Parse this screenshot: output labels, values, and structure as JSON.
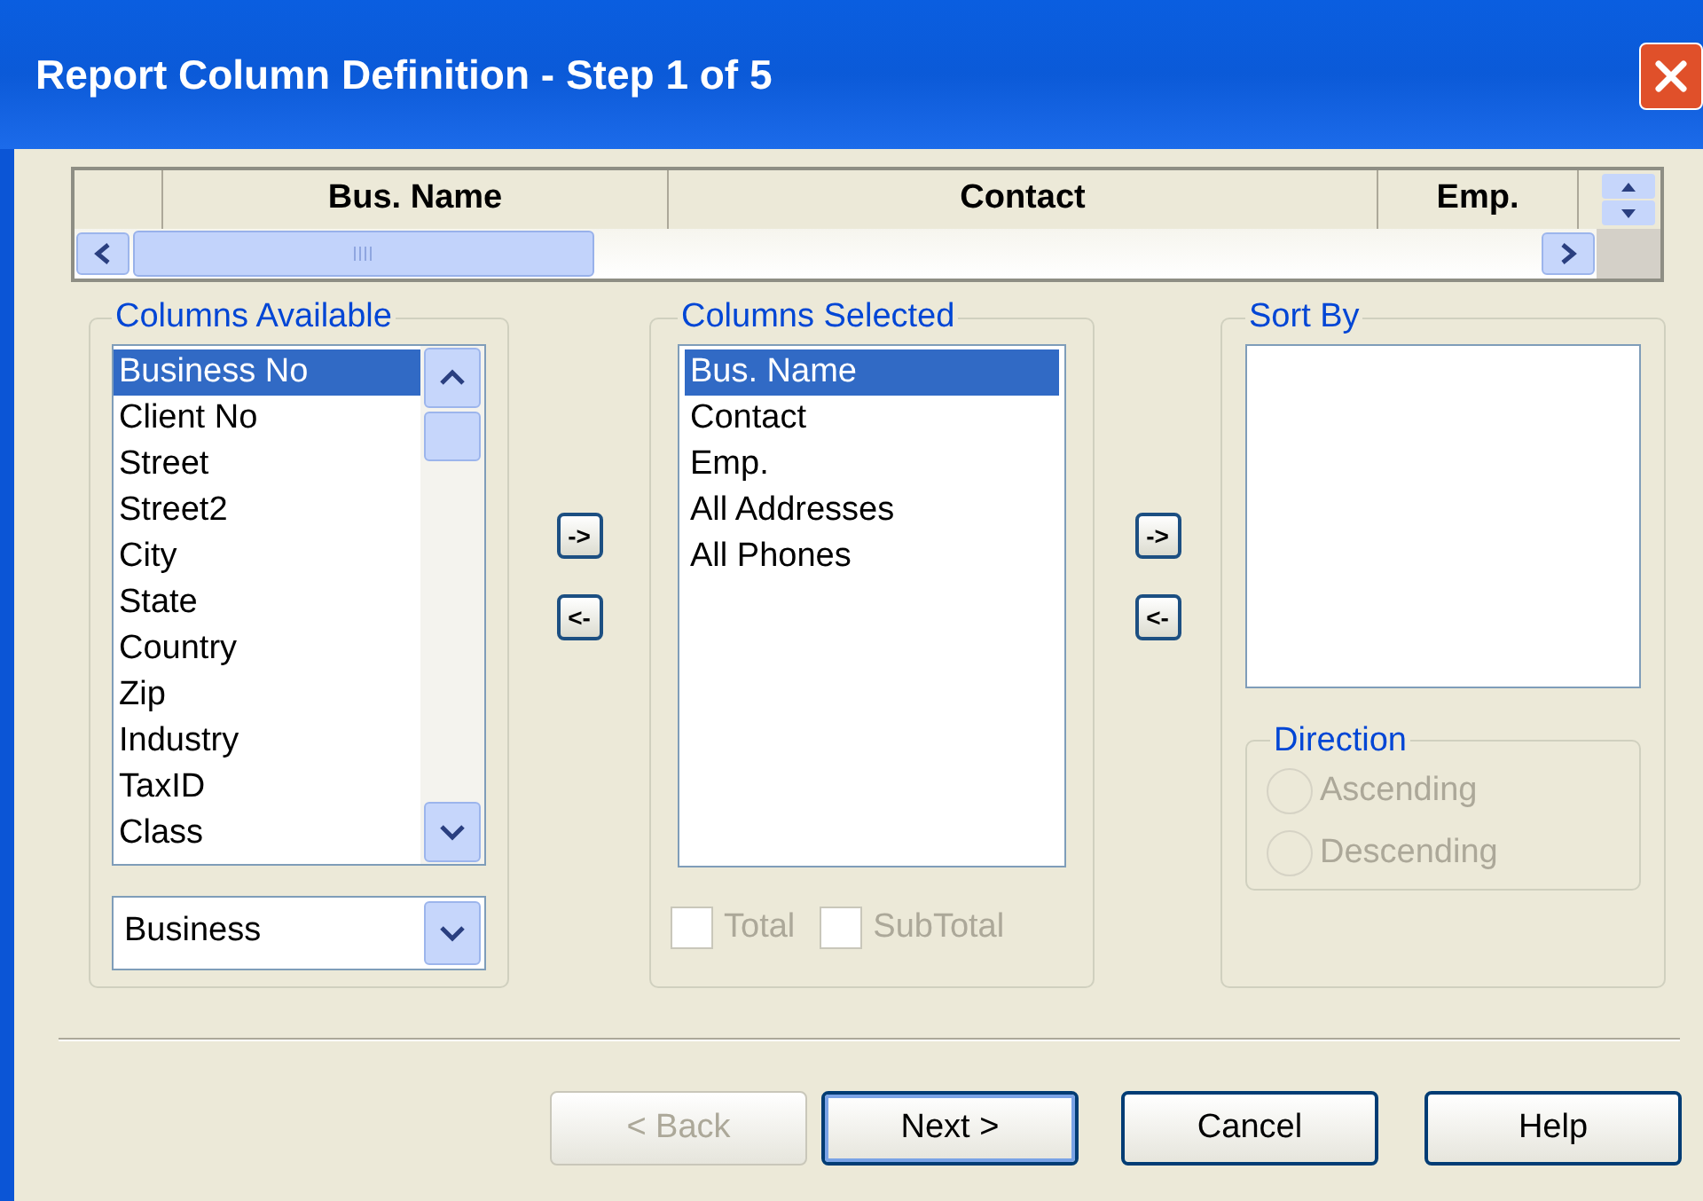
{
  "window": {
    "title": "Report Column Definition - Step 1 of 5"
  },
  "grid_preview": {
    "columns": [
      "Bus. Name",
      "Contact",
      "Emp."
    ]
  },
  "columns_available": {
    "legend": "Columns Available",
    "items": [
      {
        "label": "Business No",
        "selected": true
      },
      {
        "label": "Client No",
        "selected": false
      },
      {
        "label": "Street",
        "selected": false
      },
      {
        "label": "Street2",
        "selected": false
      },
      {
        "label": "City",
        "selected": false
      },
      {
        "label": "State",
        "selected": false
      },
      {
        "label": "Country",
        "selected": false
      },
      {
        "label": "Zip",
        "selected": false
      },
      {
        "label": "Industry",
        "selected": false
      },
      {
        "label": "TaxID",
        "selected": false
      },
      {
        "label": "Class",
        "selected": false
      }
    ],
    "dropdown": {
      "value": "Business"
    }
  },
  "add_remove_buttons": [
    "->",
    "<-"
  ],
  "columns_selected": {
    "legend": "Columns Selected",
    "items": [
      {
        "label": "Bus. Name",
        "selected": true
      },
      {
        "label": "Contact",
        "selected": false
      },
      {
        "label": "Emp.",
        "selected": false
      },
      {
        "label": "All Addresses",
        "selected": false
      },
      {
        "label": "All Phones",
        "selected": false
      }
    ],
    "checkboxes": [
      {
        "label": "Total",
        "checked": false,
        "disabled": true
      },
      {
        "label": "SubTotal",
        "checked": false,
        "disabled": true
      }
    ]
  },
  "sort_buttons": [
    "->",
    "<-"
  ],
  "sort_by": {
    "legend": "Sort By"
  },
  "direction": {
    "legend": "Direction",
    "options": [
      {
        "label": "Ascending",
        "selected": false,
        "disabled": true
      },
      {
        "label": "Descending",
        "selected": false,
        "disabled": true
      }
    ]
  },
  "buttons": [
    {
      "label": "< Back",
      "disabled": true,
      "default": false
    },
    {
      "label": "Next >",
      "disabled": false,
      "default": true
    },
    {
      "label": "Cancel",
      "disabled": false,
      "default": false
    },
    {
      "label": "Help",
      "disabled": false,
      "default": false
    }
  ]
}
